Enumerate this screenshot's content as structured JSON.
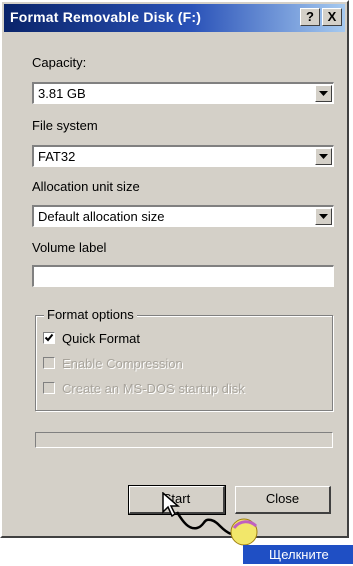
{
  "dialog": {
    "title": "Format Removable Disk (F:)",
    "help_button": "?",
    "close_button": "X",
    "capacity": {
      "label": "Capacity:",
      "value": "3.81 GB"
    },
    "file_system": {
      "label": "File system",
      "value": "FAT32"
    },
    "allocation": {
      "label": "Allocation unit size",
      "value": "Default allocation size"
    },
    "volume_label": {
      "label": "Volume label",
      "value": ""
    },
    "format_options": {
      "legend": "Format options",
      "options": [
        {
          "label": "Quick Format",
          "checked": true,
          "enabled": true
        },
        {
          "label": "Enable Compression",
          "checked": false,
          "enabled": false
        },
        {
          "label": "Create an MS-DOS startup disk",
          "checked": false,
          "enabled": false
        }
      ]
    },
    "progress": 0,
    "start_button": "Start",
    "close_label": "Close"
  },
  "callout": {
    "text": "Щелкните"
  },
  "colors": {
    "titlebar_start": "#0a246a",
    "face": "#d4d0c8",
    "callout_bg": "#1f4fc4"
  }
}
